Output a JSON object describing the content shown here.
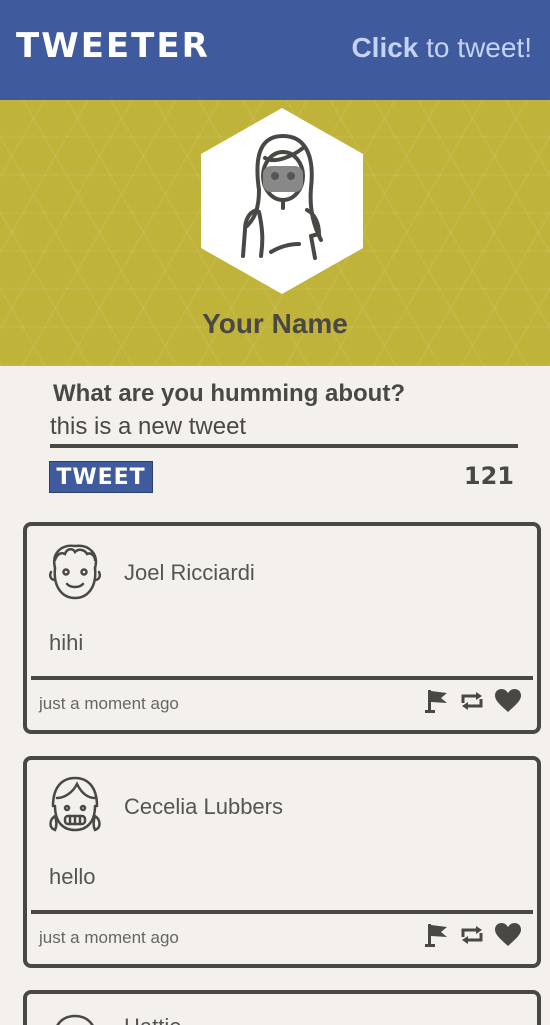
{
  "nav": {
    "brand": "TWEETER",
    "cta_bold": "Click",
    "cta_rest": " to tweet!"
  },
  "profile": {
    "name": "Your Name"
  },
  "compose": {
    "label": "What are you humming about?",
    "value": "this is a new tweet",
    "button_label": "TWEET",
    "char_count": "121"
  },
  "tweets": [
    {
      "user": "Joel Ricciardi",
      "text": "hihi",
      "time": "just a moment ago"
    },
    {
      "user": "Cecelia Lubbers",
      "text": "hello",
      "time": "just a moment ago"
    },
    {
      "user": "Hattie"
    }
  ],
  "colors": {
    "nav": "#3f5a9d",
    "profile_bg": "#c0b33a",
    "ink": "#4a4845",
    "page": "#f4f1ec",
    "cta": "#c4d3f6"
  },
  "icons": [
    "flag-icon",
    "retweet-icon",
    "heart-icon",
    "avatar-icon"
  ]
}
